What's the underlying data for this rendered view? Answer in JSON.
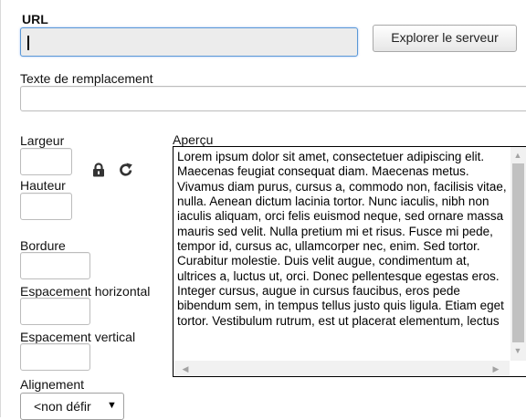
{
  "url": {
    "label": "URL",
    "value": "",
    "browse_button": "Explorer le serveur"
  },
  "alt_text": {
    "label": "Texte de remplacement",
    "value": ""
  },
  "dimensions": {
    "width_label": "Largeur",
    "height_label": "Hauteur",
    "width_value": "",
    "height_value": ""
  },
  "border": {
    "label": "Bordure",
    "value": ""
  },
  "hspace": {
    "label": "Espacement horizontal",
    "value": ""
  },
  "vspace": {
    "label": "Espacement vertical",
    "value": ""
  },
  "alignment": {
    "label": "Alignement",
    "selected": "<non défini>",
    "selected_visible": "<non défir",
    "arrow": "▼"
  },
  "preview": {
    "label": "Aperçu",
    "text": "Lorem ipsum dolor sit amet, consectetuer adipiscing elit. Maecenas feugiat consequat diam. Maecenas metus. Vivamus diam purus, cursus a, commodo non, facilisis vitae, nulla. Aenean dictum lacinia tortor. Nunc iaculis, nibh non iaculis aliquam, orci felis euismod neque, sed ornare massa mauris sed velit. Nulla pretium mi et risus. Fusce mi pede, tempor id, cursus ac, ullamcorper nec, enim. Sed tortor. Curabitur molestie. Duis velit augue, condimentum at, ultrices a, luctus ut, orci. Donec pellentesque egestas eros. Integer cursus, augue in cursus faucibus, eros pede bibendum sem, in tempus tellus justo quis ligula. Etiam eget tortor. Vestibulum rutrum, est ut placerat elementum, lectus"
  },
  "icons": {
    "lock": "lock-icon",
    "reset": "reset-size-icon"
  }
}
